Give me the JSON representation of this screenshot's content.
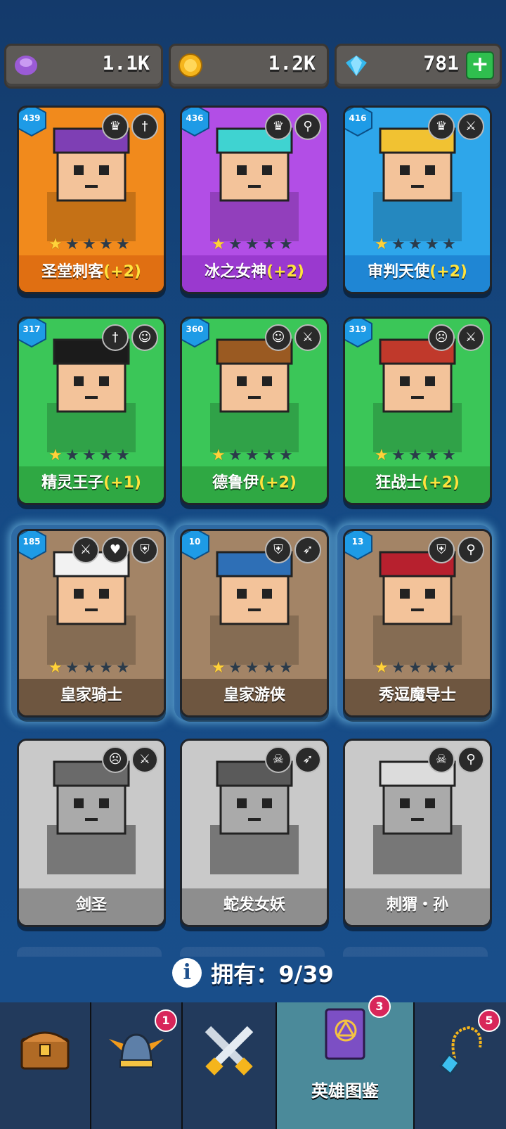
{
  "currencies": [
    {
      "name": "purple-orb",
      "value": "1.1K",
      "color": "#a060d8"
    },
    {
      "name": "gold-coin",
      "value": "1.2K",
      "color": "#f5b51c"
    },
    {
      "name": "gem",
      "value": "781",
      "color": "#3cc0f0"
    }
  ],
  "add_label": "+",
  "heroes": [
    {
      "level": "439",
      "name": "圣堂刺客",
      "bonus": "(+2)",
      "stars": 1,
      "theme": "#f18a1c",
      "bar": "#e06f12",
      "tags": [
        "wings",
        "dagger"
      ],
      "portrait": "#7e3fb4"
    },
    {
      "level": "436",
      "name": "冰之女神",
      "bonus": "(+2)",
      "stars": 1,
      "theme": "#b24ee6",
      "bar": "#9a39cf",
      "tags": [
        "wings",
        "staff"
      ],
      "portrait": "#3fd3d1"
    },
    {
      "level": "416",
      "name": "审判天使",
      "bonus": "(+2)",
      "stars": 1,
      "theme": "#2ea6ea",
      "bar": "#1f86d4",
      "tags": [
        "wings",
        "sword"
      ],
      "portrait": "#f1c232"
    },
    {
      "level": "317",
      "name": "精灵王子",
      "bonus": "(+1)",
      "stars": 1,
      "theme": "#3bc658",
      "bar": "#2fa843",
      "tags": [
        "dagger",
        "elf"
      ],
      "portrait": "#1b1b1b"
    },
    {
      "level": "360",
      "name": "德鲁伊",
      "bonus": "(+2)",
      "stars": 1,
      "theme": "#3bc658",
      "bar": "#2fa843",
      "tags": [
        "elf",
        "sword"
      ],
      "portrait": "#9a5a22"
    },
    {
      "level": "319",
      "name": "狂战士",
      "bonus": "(+2)",
      "stars": 1,
      "theme": "#3bc658",
      "bar": "#2fa843",
      "tags": [
        "orc",
        "sword"
      ],
      "portrait": "#c0392b"
    },
    {
      "level": "185",
      "name": "皇家骑士",
      "bonus": "",
      "stars": 1,
      "theme": "#a38466",
      "bar": "#6e5640",
      "tags": [
        "sword",
        "heart",
        "helmet"
      ],
      "portrait": "#f2f2f2"
    },
    {
      "level": "10",
      "name": "皇家游侠",
      "bonus": "",
      "stars": 1,
      "theme": "#a38466",
      "bar": "#6e5640",
      "tags": [
        "helmet",
        "bow"
      ],
      "portrait": "#2e6fb6"
    },
    {
      "level": "13",
      "name": "秀逗魔导士",
      "bonus": "",
      "stars": 1,
      "theme": "#a38466",
      "bar": "#6e5640",
      "tags": [
        "helmet",
        "staff"
      ],
      "portrait": "#b7202e"
    },
    {
      "level": "",
      "name": "剑圣",
      "bonus": "",
      "stars": 0,
      "theme": "#c9c9c9",
      "bar": "#8e8e8e",
      "tags": [
        "orc",
        "sword"
      ],
      "portrait": "#6a6a6a"
    },
    {
      "level": "",
      "name": "蛇发女妖",
      "bonus": "",
      "stars": 0,
      "theme": "#c9c9c9",
      "bar": "#8e8e8e",
      "tags": [
        "skull",
        "bow"
      ],
      "portrait": "#5a5a5a"
    },
    {
      "level": "",
      "name": "刺猬・孙",
      "bonus": "",
      "stars": 0,
      "theme": "#c9c9c9",
      "bar": "#8e8e8e",
      "tags": [
        "skull",
        "staff"
      ],
      "portrait": "#dcdcdc"
    }
  ],
  "owned": {
    "label": "拥有：",
    "count": "9/39"
  },
  "nav": [
    {
      "name": "chest",
      "label": "",
      "badge": ""
    },
    {
      "name": "helmet",
      "label": "",
      "badge": "1"
    },
    {
      "name": "swords",
      "label": "",
      "badge": ""
    },
    {
      "name": "codex",
      "label": "英雄图鉴",
      "badge": "3"
    },
    {
      "name": "amulet",
      "label": "",
      "badge": "5"
    }
  ]
}
